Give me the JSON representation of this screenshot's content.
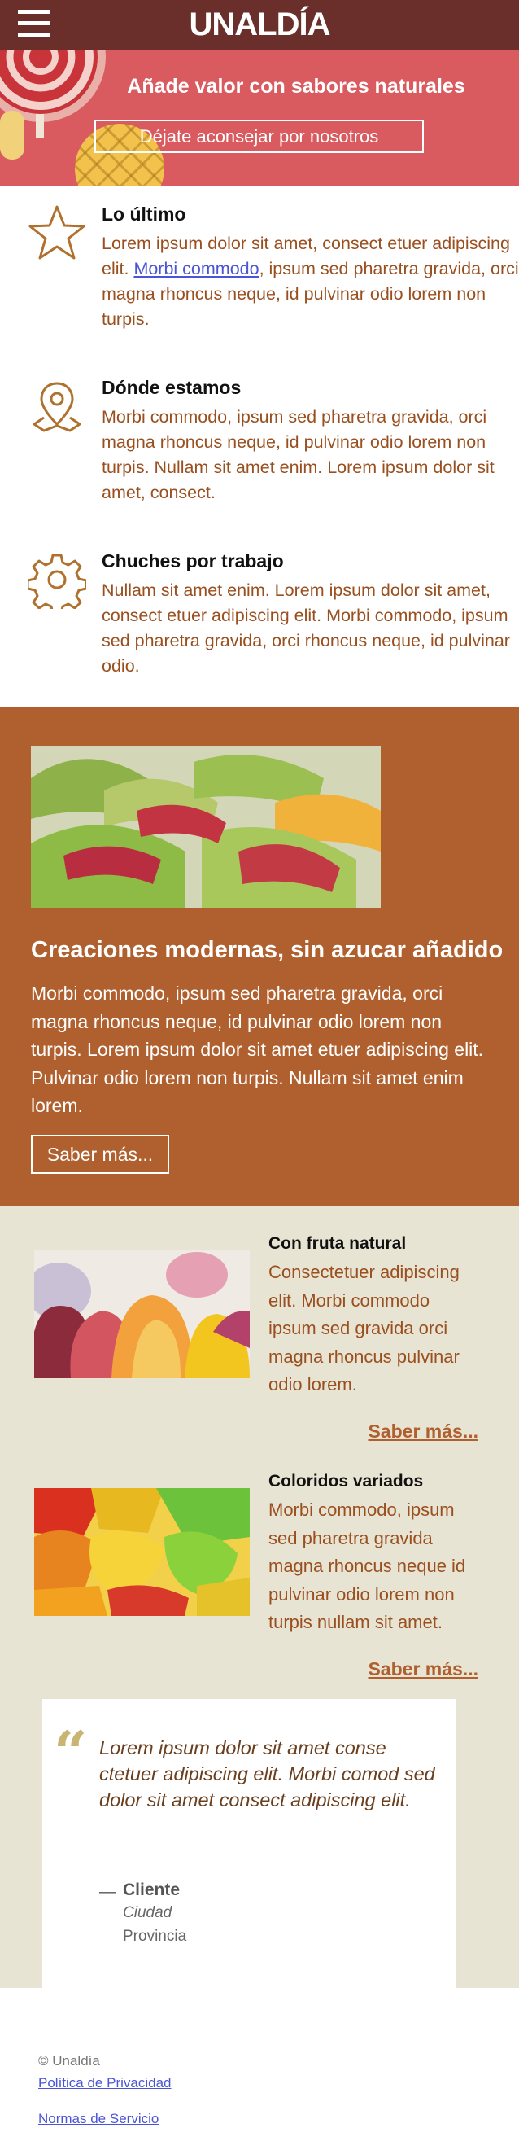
{
  "header": {
    "brand": "UNALDÍA",
    "menu_icon": "hamburger-menu-icon"
  },
  "hero": {
    "title": "Añade valor con sabores naturales",
    "button_label": "Déjate aconsejar por nosotros"
  },
  "features": [
    {
      "icon": "star-icon",
      "title": "Lo último",
      "text_before": "Lorem ipsum dolor sit amet, consect etuer adipiscing elit. ",
      "link": "Morbi commodo",
      "text_after": ", ipsum sed pharetra gravida, orci magna rhoncus neque, id pulvinar odio lorem non turpis."
    },
    {
      "icon": "map-pin-icon",
      "title": "Dónde estamos",
      "text": "Morbi commodo, ipsum sed pharetra gravida, orci magna rhoncus neque, id pulvinar odio lorem non turpis. Nullam sit amet enim. Lorem ipsum dolor sit amet, consect."
    },
    {
      "icon": "gear-icon",
      "title": "Chuches por trabajo",
      "text": "Nullam sit amet enim. Lorem ipsum dolor sit amet, consect etuer adipiscing elit. Morbi commodo, ipsum sed pharetra gravida, orci rhoncus neque, id pulvinar odio."
    }
  ],
  "band": {
    "title": "Creaciones modernas, sin azucar añadido",
    "text": "Morbi commodo, ipsum sed pharetra gravida, orci magna rhoncus neque, id pulvinar odio lorem non turpis. Lorem ipsum dolor sit amet etuer adipiscing elit. Pulvinar odio lorem non turpis. Nullam sit amet enim lorem.",
    "button_label": "Saber más..."
  },
  "cards": [
    {
      "title": "Con fruta natural",
      "text": "Consectetuer adipiscing elit. Morbi commodo ipsum sed gravida orci magna rhoncus pulvinar odio lorem.",
      "link": "Saber más..."
    },
    {
      "title": "Coloridos variados",
      "text": "Morbi commodo, ipsum sed pharetra gravida magna rhoncus neque id pulvinar odio lorem non turpis nullam sit amet.",
      "link": "Saber más..."
    }
  ],
  "testimonial": {
    "quote": "Lorem ipsum dolor sit amet conse ctetuer adipiscing elit. Morbi comod sed dolor sit amet consect adipiscing elit.",
    "dash": "—",
    "name": "Cliente",
    "city": "Ciudad",
    "province": "Provincia"
  },
  "footer": {
    "copyright": "© Unaldía",
    "privacy": "Política de Privacidad",
    "terms": "Normas de Servicio"
  },
  "colors": {
    "topbar": "#6a2f2a",
    "hero": "#d95a5f",
    "band": "#b0602e",
    "beige": "#e8e4d4",
    "accent_text": "#9a4f1f"
  }
}
